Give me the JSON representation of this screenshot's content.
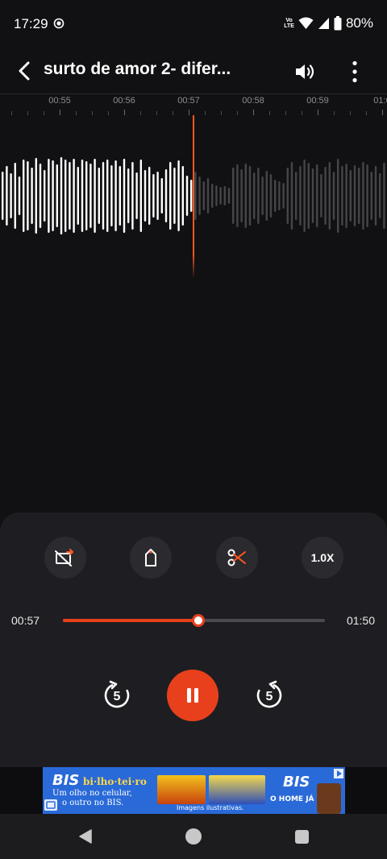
{
  "status_bar": {
    "time": "17:29",
    "network_badge": [
      "Vo",
      "LTE"
    ],
    "battery": "80%",
    "icons": [
      "screen-record-icon",
      "wifi-icon",
      "signal-icon",
      "battery-icon"
    ]
  },
  "header": {
    "title": "surto de amor 2- difer...",
    "icons": [
      "back-arrow-icon",
      "volume-icon",
      "more-vert-icon"
    ]
  },
  "timeline": {
    "labels": [
      "00:55",
      "00:56",
      "00:57",
      "00:58",
      "00:59",
      "01:0"
    ]
  },
  "tools": {
    "speed_label": "1.0X",
    "icons": [
      "skip-silence-icon",
      "bookmark-icon",
      "trim-scissors-icon"
    ]
  },
  "playback": {
    "current_time": "00:57",
    "total_time": "01:50",
    "progress": 0.5182,
    "rewind_seconds": "5",
    "forward_seconds": "5",
    "state": "playing"
  },
  "ad": {
    "brand": "BIS",
    "headline": "bi·lho·tei·ro",
    "line1": "Um olho no celular,",
    "line2": "o outro no BIS.",
    "caption": "Imagens ilustrativas.",
    "tagline": "O HOME JÁ DIZ"
  },
  "colors": {
    "accent": "#e8401c",
    "background": "#111113",
    "panel": "#1e1e22"
  }
}
